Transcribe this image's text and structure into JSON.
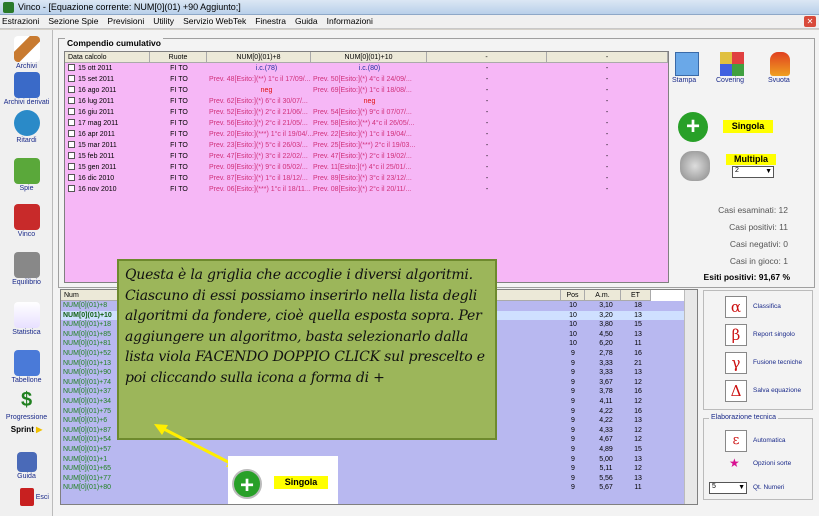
{
  "window": {
    "title": "Vinco - [Equazione corrente: NUM[0](01) +90 Aggiunto;]"
  },
  "menu": [
    "Estrazioni",
    "Sezione Spie",
    "Previsioni",
    "Utility",
    "Servizio WebTek",
    "Finestra",
    "Guida",
    "Informazioni"
  ],
  "sidebar": [
    "Archivi",
    "Archivi derivati",
    "Ritardi",
    "Spie",
    "Vinco",
    "Equilibrio",
    "Statistica",
    "Tabellone",
    "Progressione",
    "Sprint",
    "Guida",
    "Esci"
  ],
  "compendio": {
    "title": "Compendio cumulativo",
    "headers": [
      "Data calcolo",
      "Ruote",
      "NUM[0](01)+8",
      "NUM[0](01)+10",
      "-",
      "-"
    ],
    "rows": [
      {
        "date": "15 ott 2011",
        "ruote": "FI TO",
        "a": "i.c.(78)",
        "b": "i.c.(80)",
        "c": "-",
        "d": "-",
        "cls": "blue"
      },
      {
        "date": "15 set 2011",
        "ruote": "FI TO",
        "a": "Prev. 48[Esito:](**) 1°c il 17/09/...",
        "b": "Prev. 50[Esito:](*) 4°c il 24/09/...",
        "c": "-",
        "d": "-"
      },
      {
        "date": "16 ago 2011",
        "ruote": "FI TO",
        "a": "neg",
        "b": "Prev. 69[Esito:](*) 1°c il 18/08/...",
        "c": "-",
        "d": "-",
        "neg": "a"
      },
      {
        "date": "16 lug 2011",
        "ruote": "FI TO",
        "a": "Prev. 62[Esito:](*) 6°c il 30/07/...",
        "b": "neg",
        "c": "-",
        "d": "-",
        "neg": "b"
      },
      {
        "date": "16 giu 2011",
        "ruote": "FI TO",
        "a": "Prev. 52[Esito:](*) 2°c il 21/06/...",
        "b": "Prev. 54[Esito:](*) 9°c il 07/07/...",
        "c": "-",
        "d": "-"
      },
      {
        "date": "17 mag 2011",
        "ruote": "FI TO",
        "a": "Prev. 56[Esito:](*) 2°c il 21/05/...",
        "b": "Prev. 58[Esito:](**) 4°c il 26/05/...",
        "c": "-",
        "d": "-"
      },
      {
        "date": "16 apr 2011",
        "ruote": "FI TO",
        "a": "Prev. 20[Esito:](***) 1°c il 19/04/...",
        "b": "Prev. 22[Esito:](*) 1°c il 19/04/...",
        "c": "-",
        "d": "-"
      },
      {
        "date": "15 mar 2011",
        "ruote": "FI TO",
        "a": "Prev. 23[Esito:](*) 5°c il 26/03/...",
        "b": "Prev. 25[Esito:](***) 2°c il 19/03...",
        "c": "-",
        "d": "-"
      },
      {
        "date": "15 feb 2011",
        "ruote": "FI TO",
        "a": "Prev. 47[Esito:](*) 3°c il 22/02/...",
        "b": "Prev. 47[Esito:](*) 2°c il 19/02/...",
        "c": "-",
        "d": "-"
      },
      {
        "date": "15 gen 2011",
        "ruote": "FI TO",
        "a": "Prev. 09[Esito:](*) 9°c il 05/02/...",
        "b": "Prev. 11[Esito:](*) 4°c il 25/01/...",
        "c": "-",
        "d": "-"
      },
      {
        "date": "16 dic 2010",
        "ruote": "FI TO",
        "a": "Prev. 87[Esito:](*) 1°c il 18/12/...",
        "b": "Prev. 89[Esito:](*) 3°c il 23/12/...",
        "c": "-",
        "d": "-"
      },
      {
        "date": "16 nov 2010",
        "ruote": "FI TO",
        "a": "Prev. 06[Esito:](***) 1°c il 18/11...",
        "b": "Prev. 08[Esito:](*) 2°c il 20/11/...",
        "c": "-",
        "d": "-"
      }
    ]
  },
  "right": {
    "stampa": "Stampa",
    "covering": "Covering",
    "svuota": "Svuota",
    "singola": "Singola",
    "multipla": "Multipla",
    "multipla_value": "2",
    "casi_esaminati": "Casi esaminati: 12",
    "casi_positivi": "Casi positivi: 11",
    "casi_negativi": "Casi negativi: 0",
    "casi_in_gioco": "Casi in gioco: 1",
    "esiti_positivi": "Esiti positivi: 91,67 %"
  },
  "algoritmi": {
    "headers": [
      "Num",
      "Pos",
      "A.m.",
      "ET"
    ],
    "rows": [
      {
        "n": "NUM[0](01)+8",
        "p": "10",
        "am": "3,10",
        "et": "18"
      },
      {
        "n": "NUM[0](01)+10",
        "p": "10",
        "am": "3,20",
        "et": "13",
        "sel": true
      },
      {
        "n": "NUM[0](01)+18",
        "p": "10",
        "am": "3,80",
        "et": "15"
      },
      {
        "n": "NUM[0](01)+85",
        "p": "10",
        "am": "4,50",
        "et": "13"
      },
      {
        "n": "NUM[0](01)+81",
        "p": "10",
        "am": "6,20",
        "et": "11"
      },
      {
        "n": "NUM[0](01)+52",
        "p": "9",
        "am": "2,78",
        "et": "16"
      },
      {
        "n": "NUM[0](01)+13",
        "p": "9",
        "am": "3,33",
        "et": "21"
      },
      {
        "n": "NUM[0](01)+90",
        "p": "9",
        "am": "3,33",
        "et": "13"
      },
      {
        "n": "NUM[0](01)+74",
        "p": "9",
        "am": "3,67",
        "et": "12"
      },
      {
        "n": "NUM[0](01)+37",
        "p": "9",
        "am": "3,78",
        "et": "16"
      },
      {
        "n": "NUM[0](01)+34",
        "p": "9",
        "am": "4,11",
        "et": "12"
      },
      {
        "n": "NUM[0](01)+75",
        "p": "9",
        "am": "4,22",
        "et": "16"
      },
      {
        "n": "NUM[0](01)+6",
        "p": "9",
        "am": "4,22",
        "et": "13"
      },
      {
        "n": "NUM[0](01)+87",
        "p": "9",
        "am": "4,33",
        "et": "12"
      },
      {
        "n": "NUM[0](01)+54",
        "p": "9",
        "am": "4,67",
        "et": "12"
      },
      {
        "n": "NUM[0](01)+57",
        "p": "9",
        "am": "4,89",
        "et": "15"
      },
      {
        "n": "NUM[0](01)+1",
        "p": "9",
        "am": "5,00",
        "et": "13"
      },
      {
        "n": "NUM[0](01)+65",
        "p": "9",
        "am": "5,11",
        "et": "12"
      },
      {
        "n": "NUM[0](01)+77",
        "p": "9",
        "am": "5,56",
        "et": "13"
      },
      {
        "n": "NUM[0](01)+80",
        "p": "9",
        "am": "5,67",
        "et": "11"
      }
    ]
  },
  "ops": [
    {
      "sym": "α",
      "label": "Classifica"
    },
    {
      "sym": "β",
      "label": "Report singolo"
    },
    {
      "sym": "γ",
      "label": "Fusione tecniche"
    },
    {
      "sym": "Δ",
      "label": "Salva equazione"
    }
  ],
  "elab": {
    "title": "Elaborazione tecnica",
    "auto_sym": "ε",
    "auto": "Automatica",
    "opzioni": "Opzioni sorte",
    "qt_value": "5",
    "qt": "Qt. Numeri"
  },
  "note": "Questa è la griglia che accoglie i diversi algoritmi. Ciascuno di essi possiamo inserirlo nella lista degli algoritmi da fondere, cioè quella esposta sopra. Per aggiungere un algoritmo, basta selezionarlo dalla lista viola FACENDO DOPPIO CLICK sul prescelto e poi cliccando sulla icona a forma di +",
  "note_button": "Singola",
  "colors": {
    "pink": "#f6b7f6",
    "violet": "#b8b8f0",
    "note": "#9cb65a",
    "accent": "#e01010"
  }
}
